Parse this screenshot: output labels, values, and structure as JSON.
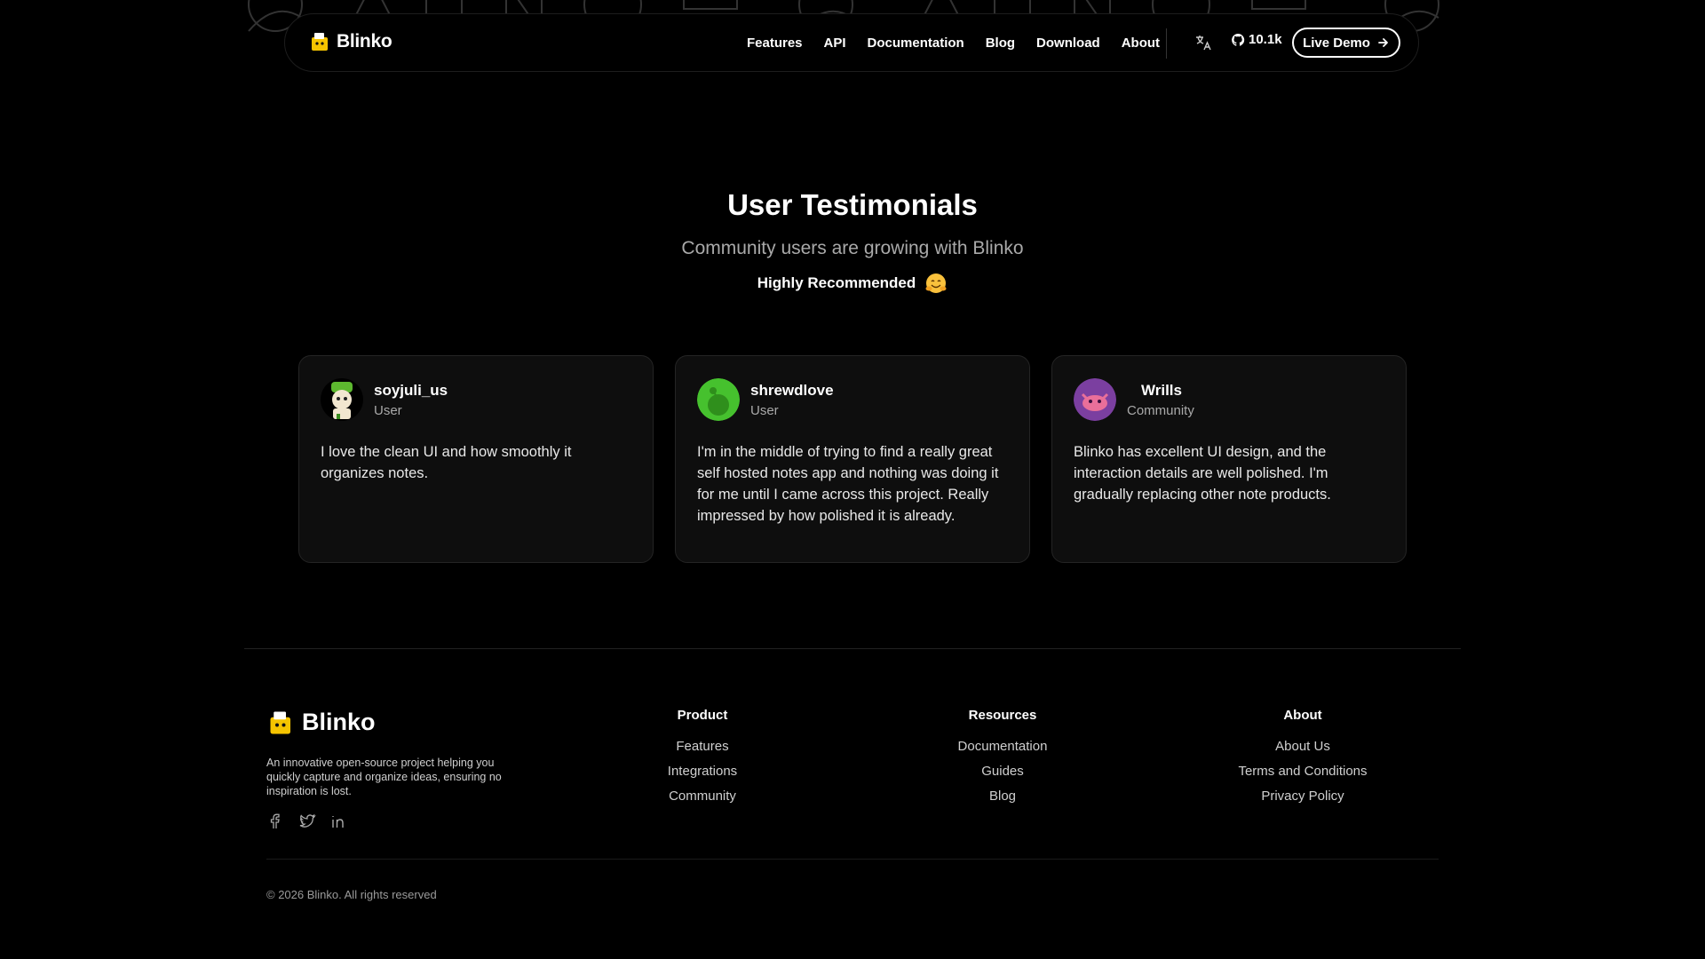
{
  "brand": {
    "name": "Blinko"
  },
  "nav": {
    "links": [
      "Features",
      "API",
      "Documentation",
      "Blog",
      "Download",
      "About"
    ],
    "stars": "10.1k",
    "demo_label": "Live Demo",
    "icons": [
      "translate-icon",
      "github-icon",
      "arrow-right-icon"
    ]
  },
  "testimonials": {
    "title": "User Testimonials",
    "subtitle": "Community users are growing with Blinko",
    "recommend": "Highly Recommended",
    "cards": [
      {
        "name": "soyjuli_us",
        "role": "User",
        "text": "I love the clean UI and how smoothly it organizes notes."
      },
      {
        "name": "shrewdlove",
        "role": "User",
        "text": "I'm in the middle of trying to find a really great self hosted notes app and nothing was doing it for me until I came across this project. Really impressed by how polished it is already."
      },
      {
        "name": "Wrills",
        "role": "Community",
        "text": "Blinko has excellent UI design, and the interaction details are well polished. I'm gradually replacing other note products."
      }
    ]
  },
  "footer": {
    "description": "An innovative open-source project helping you quickly capture and organize ideas, ensuring no inspiration is lost.",
    "social": [
      "facebook-icon",
      "twitter-icon",
      "linkedin-icon"
    ],
    "columns": [
      {
        "title": "Product",
        "links": [
          "Features",
          "Integrations",
          "Community"
        ]
      },
      {
        "title": "Resources",
        "links": [
          "Documentation",
          "Guides",
          "Blog"
        ]
      },
      {
        "title": "About",
        "links": [
          "About Us",
          "Terms and Conditions",
          "Privacy Policy"
        ]
      }
    ],
    "copyright": "© 2026 Blinko. All rights reserved"
  },
  "colors": {
    "background": "#000000",
    "card": "#0e0e0e",
    "muted": "#a9a9a9",
    "logo_yellow": "#f5c400"
  }
}
